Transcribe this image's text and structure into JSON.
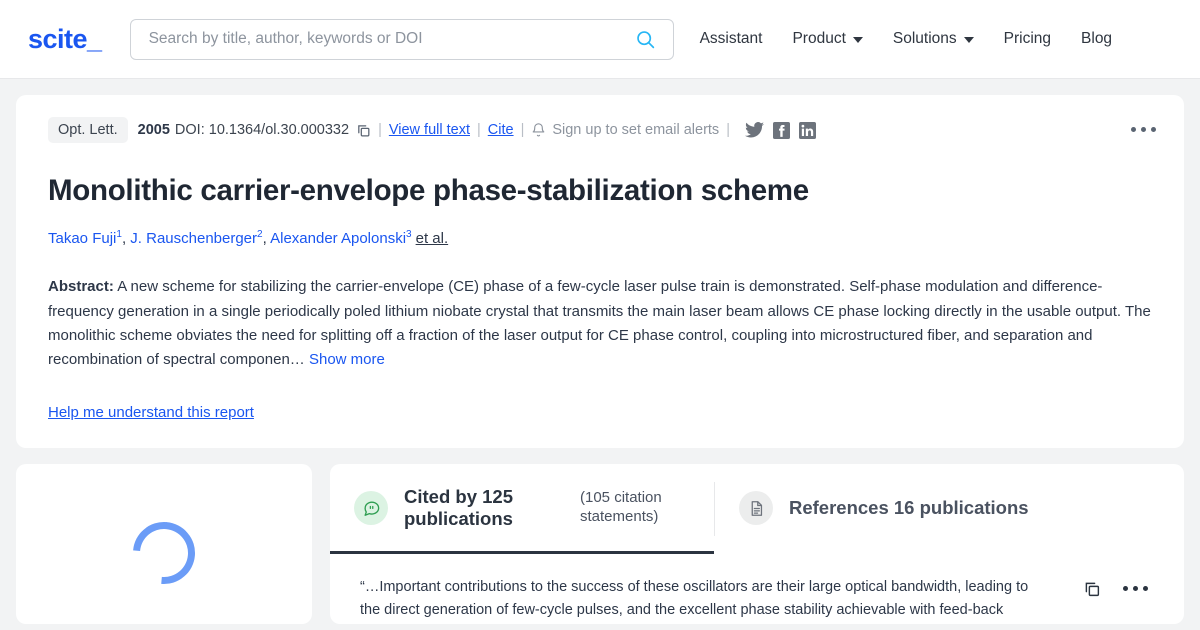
{
  "header": {
    "logo": "scite_",
    "search": {
      "placeholder": "Search by title, author, keywords or DOI",
      "value": "",
      "icon": "search-icon"
    },
    "nav": [
      {
        "label": "Assistant",
        "caret": false
      },
      {
        "label": "Product",
        "caret": true
      },
      {
        "label": "Solutions",
        "caret": true
      },
      {
        "label": "Pricing",
        "caret": false
      },
      {
        "label": "Blog",
        "caret": false
      }
    ]
  },
  "paper": {
    "journal": "Opt. Lett.",
    "year": "2005",
    "doi": "DOI: 10.1364/ol.30.000332",
    "copy_doi_icon": "copy-icon",
    "view_full_text": "View full text",
    "cite": "Cite",
    "alerts": "Sign up to set email alerts",
    "alerts_icon": "bell-icon",
    "separator": "|",
    "socials": [
      {
        "name": "twitter-icon",
        "label": "Twitter"
      },
      {
        "name": "facebook-icon",
        "label": "Facebook"
      },
      {
        "name": "linkedin-icon",
        "label": "LinkedIn"
      }
    ],
    "title": "Monolithic carrier-envelope phase-stabilization scheme",
    "authors": [
      {
        "name": "Takao Fuji",
        "affiliation": "1"
      },
      {
        "name": "J. Rauschenberger",
        "affiliation": "2"
      },
      {
        "name": "Alexander Apolonski",
        "affiliation": "3"
      }
    ],
    "et_al": "et al.",
    "abstract_label": "Abstract:",
    "abstract_text": " A new scheme for stabilizing the carrier-envelope (CE) phase of a few-cycle laser pulse train is demonstrated. Self-phase modulation and difference-frequency generation in a single periodically poled lithium niobate crystal that transmits the main laser beam allows CE phase locking directly in the usable output. The monolithic scheme obviates the need for splitting off a fraction of the laser output for CE phase control, coupling into microstructured fiber, and separation and recombination of spectral componen… ",
    "show_more": "Show more",
    "help_link": "Help me understand this report",
    "more_menu": "more-options"
  },
  "tabs": [
    {
      "id": "cited-by",
      "icon": "quote-bubble-icon",
      "title": "Cited by 125 publications",
      "subtitle": "(105 citation statements)",
      "active": true
    },
    {
      "id": "references",
      "icon": "document-icon",
      "title": "References 16 publications",
      "subtitle": "",
      "active": false
    }
  ],
  "citation": {
    "text": "“…Important contributions to the success of these oscillators are their large optical bandwidth, leading to the direct generation of few-cycle pulses, and the excellent phase stability achievable with feed-back",
    "copy_icon": "copy-icon",
    "more_icon": "more-options-icon"
  },
  "sidebar": {
    "loading": "spinner"
  },
  "colors": {
    "accent_blue": "#1a56f0",
    "page_bg": "#f2f3f4",
    "card_bg": "#ffffff",
    "tab_active_underline": "#2b3440",
    "quote_icon_bg": "#dcf3e3",
    "spinner": "#6b9cf7"
  }
}
